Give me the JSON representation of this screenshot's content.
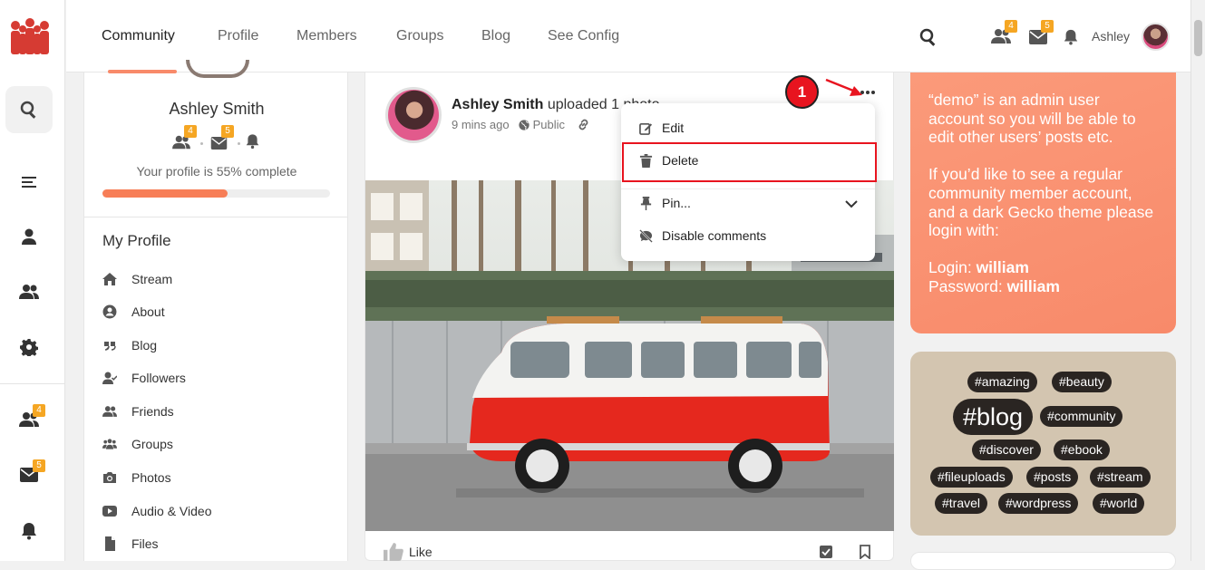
{
  "nav": {
    "items": [
      {
        "label": "Community"
      },
      {
        "label": "Profile"
      },
      {
        "label": "Members"
      },
      {
        "label": "Groups"
      },
      {
        "label": "Blog"
      },
      {
        "label": "See Config"
      }
    ],
    "friends_badge": "4",
    "messages_badge": "5",
    "username": "Ashley"
  },
  "rail": {
    "friends_badge": "4",
    "messages_badge": "5"
  },
  "profile": {
    "name": "Ashley Smith",
    "friends_badge": "4",
    "messages_badge": "5",
    "completion_text": "Your profile is 55% complete",
    "completion_percent": 55,
    "section_title": "My Profile",
    "menu": [
      {
        "label": "Stream",
        "icon": "home-icon"
      },
      {
        "label": "About",
        "icon": "user-circle-icon"
      },
      {
        "label": "Blog",
        "icon": "quote-icon"
      },
      {
        "label": "Followers",
        "icon": "user-check-icon"
      },
      {
        "label": "Friends",
        "icon": "users-icon"
      },
      {
        "label": "Groups",
        "icon": "group-icon"
      },
      {
        "label": "Photos",
        "icon": "camera-icon"
      },
      {
        "label": "Audio & Video",
        "icon": "play-icon"
      },
      {
        "label": "Files",
        "icon": "file-icon"
      }
    ]
  },
  "post": {
    "author": "Ashley Smith",
    "action": "uploaded 1 photo",
    "time": "9 mins ago",
    "visibility": "Public",
    "like_label": "Like"
  },
  "dropdown": {
    "items": [
      {
        "label": "Edit",
        "icon": "edit-icon"
      },
      {
        "label": "Delete",
        "icon": "trash-icon"
      },
      {
        "label": "Pin...",
        "icon": "pin-icon"
      },
      {
        "label": "Disable comments",
        "icon": "comment-off-icon"
      }
    ]
  },
  "annotation": {
    "step_number": "1"
  },
  "notice": {
    "para1": "“demo” is an admin user account so you will be able to edit other users’ posts etc.",
    "para2": "If you’d like to see a regular community member account, and a dark Gecko theme please login with:",
    "login_label": "Login:",
    "login_value": "william",
    "password_label": "Password:",
    "password_value": "william"
  },
  "tags": [
    "#amazing",
    "#beauty",
    "#blog",
    "#community",
    "#discover",
    "#ebook",
    "#fileuploads",
    "#posts",
    "#stream",
    "#travel",
    "#wordpress",
    "#world"
  ],
  "colors": {
    "accent": "#f88a6a",
    "badge": "#f5a623",
    "highlight": "#e8141f",
    "tag_bg": "#2a2522",
    "tagcloud_bg": "#d3c5b0"
  }
}
